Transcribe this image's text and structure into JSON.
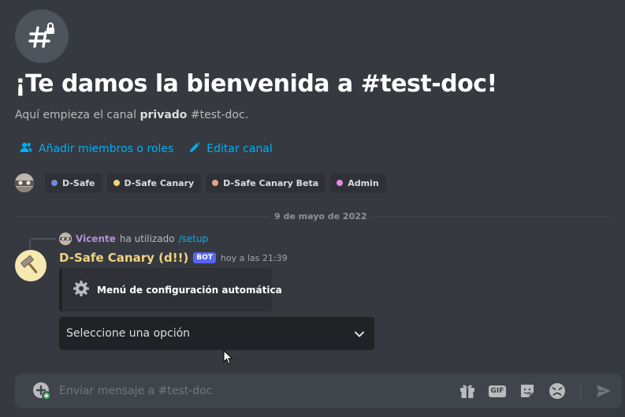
{
  "welcome": {
    "title": "¡Te damos la bienvenida a #test-doc!",
    "subtitle_prefix": "Aquí empieza el canal ",
    "subtitle_bold": "privado",
    "subtitle_suffix": " #test-doc."
  },
  "actions": {
    "add_members": "Añadir miembros o roles",
    "edit_channel": "Editar canal"
  },
  "roles": [
    {
      "name": "D-Safe",
      "color": "#7289da"
    },
    {
      "name": "D-Safe Canary",
      "color": "#f0d480"
    },
    {
      "name": "D-Safe Canary Beta",
      "color": "#e0a48c"
    },
    {
      "name": "Admin",
      "color": "#e68ae6"
    }
  ],
  "divider": {
    "date": "9 de mayo de 2022"
  },
  "reply": {
    "user": "Vicente",
    "action": "ha utilizado",
    "command": "/setup"
  },
  "message": {
    "author": "D-Safe Canary (d!!)",
    "tag": "BOT",
    "timestamp": "hoy a las 21:39",
    "embed_title": "Menú de configuración automática",
    "select_placeholder": "Seleccione una opción"
  },
  "composer": {
    "placeholder": "Enviar mensaje a #test-doc",
    "gif_label": "GIF"
  },
  "colors": {
    "background": "#36393f",
    "link": "#00aff4",
    "bot_name": "#f0d480",
    "bot_tag": "#5865f2"
  },
  "icons": {
    "channel": "hashtag-lock-icon",
    "add_members": "add-member-icon",
    "edit": "pencil-icon",
    "embed": "gear-icon",
    "select": "chevron-down-icon",
    "attach": "plus-circle-icon",
    "gift": "gift-icon",
    "gif": "gif-icon",
    "sticker": "sticker-icon",
    "emoji": "emoji-icon",
    "send": "send-icon"
  }
}
